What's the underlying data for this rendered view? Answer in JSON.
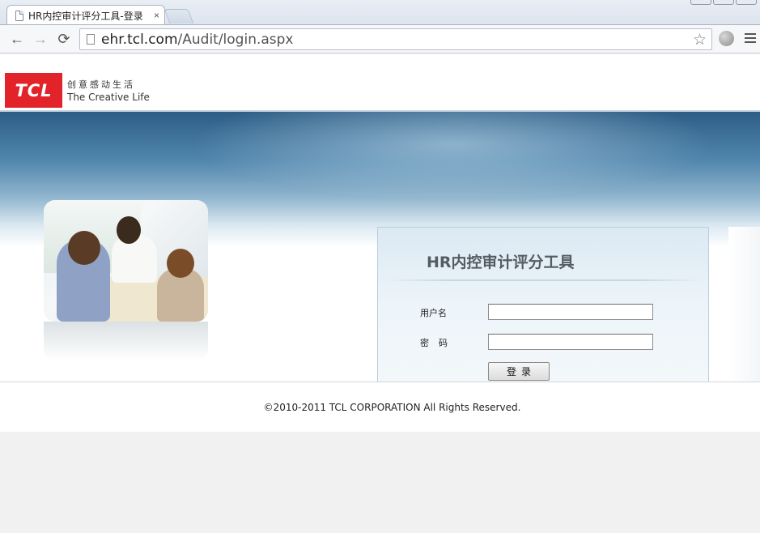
{
  "browser": {
    "tab_title": "HR内控审计评分工具-登录",
    "tab_close": "×",
    "url_host": "ehr.tcl.com",
    "url_path": "/Audit/login.aspx",
    "back": "←",
    "forward": "→",
    "reload": "⟳",
    "star": "☆"
  },
  "header": {
    "logo_text": "TCL",
    "slogan_cn": "创意感动生活",
    "slogan_en": "The Creative Life"
  },
  "login": {
    "title": "HR内控审计评分工具",
    "username_label": "用户名",
    "username_value": "",
    "password_label": "密码",
    "password_value": "",
    "submit_label": "登录"
  },
  "footer": {
    "copyright": "©2010-2011 TCL CORPORATION All Rights Reserved."
  }
}
